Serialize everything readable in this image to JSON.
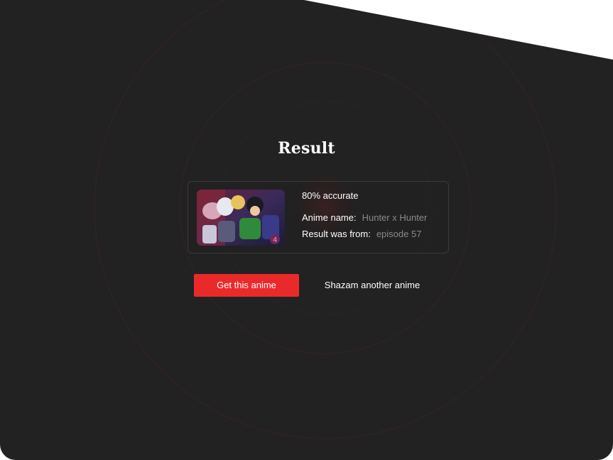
{
  "result": {
    "title": "Result",
    "accuracy": "80% accurate",
    "anime_name_label": "Anime name:",
    "anime_name_value": "Hunter x Hunter",
    "source_label": "Result was from:",
    "source_value": "episode 57"
  },
  "actions": {
    "primary_label": "Get this anime",
    "secondary_label": "Shazam another anime"
  },
  "colors": {
    "background": "#222222",
    "accent": "#ea2a2a",
    "muted_text": "#8a8a8a"
  }
}
